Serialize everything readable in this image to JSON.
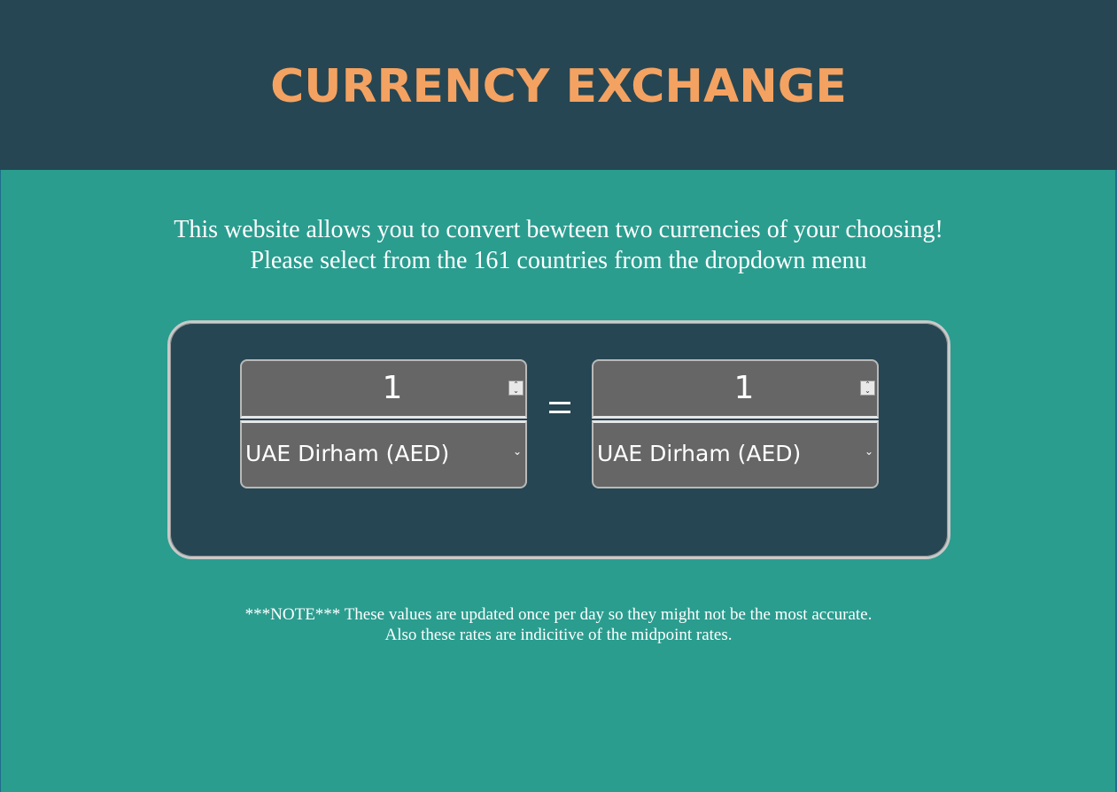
{
  "header": {
    "title": "CURRENCY EXCHANGE"
  },
  "intro": {
    "line1": "This website allows you to convert bewteen two currencies of your choosing!",
    "line2": "Please select from the 161 countries from the dropdown menu"
  },
  "converter": {
    "left": {
      "amount": "1",
      "currency": "UAE Dirham (AED)"
    },
    "equals_symbol": "=",
    "right": {
      "amount": "1",
      "currency": "UAE Dirham (AED)"
    }
  },
  "note": {
    "line1": "***NOTE*** These values are updated once per day so they might not be the most accurate.",
    "line2": "Also these rates are indicitive of the midpoint rates."
  },
  "colors": {
    "header_bg": "#264653",
    "title": "#f4a261",
    "page_bg": "#2a9d8f",
    "panel_bg": "#264653",
    "field_bg": "#666666"
  },
  "icons": {
    "spinner": "spinner-icon",
    "dropdown": "chevron-down-icon"
  }
}
